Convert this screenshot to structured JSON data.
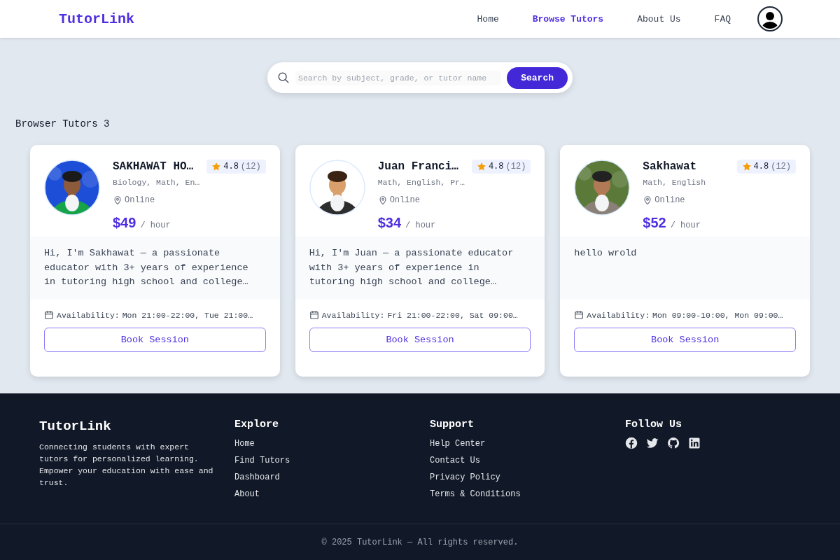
{
  "header": {
    "logo": "TutorLink",
    "nav": [
      {
        "label": "Home",
        "selected": false
      },
      {
        "label": "Browse Tutors",
        "selected": true
      },
      {
        "label": "About Us",
        "selected": false
      },
      {
        "label": "FAQ",
        "selected": false
      }
    ]
  },
  "search": {
    "placeholder": "Search by subject, grade, or tutor name",
    "button": "Search"
  },
  "heading": "Browser Tutors 3",
  "tutors": [
    {
      "name": "SAKHAWAT HO…",
      "rating": "4.8",
      "reviews": "(12)",
      "subjects": "Biology, Math, En…",
      "location": "Online",
      "price": "$49",
      "unit": "/ hour",
      "bio": "Hi, I'm Sakhawat — a passionate educator with 3+ years of experience in tutoring high school and college…",
      "availability_label": "Availability:",
      "availability": "Mon 21:00-22:00, Tue 21:00…",
      "button": "Book Session"
    },
    {
      "name": "Juan Franci…",
      "rating": "4.8",
      "reviews": "(12)",
      "subjects": "Math, English, Pr…",
      "location": "Online",
      "price": "$34",
      "unit": "/ hour",
      "bio": "Hi, I'm Juan — a passionate educator with 3+ years of experience in tutoring high school and college…",
      "availability_label": "Availability:",
      "availability": "Fri 21:00-22:00, Sat 09:00…",
      "button": "Book Session"
    },
    {
      "name": "Sakhawat",
      "rating": "4.8",
      "reviews": "(12)",
      "subjects": "Math, English",
      "location": "Online",
      "price": "$52",
      "unit": "/ hour",
      "bio": "hello wrold",
      "availability_label": "Availability:",
      "availability": "Mon 09:00-10:00, Mon 09:00…",
      "button": "Book Session"
    }
  ],
  "footer": {
    "brand": "TutorLink",
    "tagline": "Connecting students with expert tutors for personalized learning. Empower your education with ease and trust.",
    "columns": [
      {
        "title": "Explore",
        "links": [
          "Home",
          "Find Tutors",
          "Dashboard",
          "About"
        ]
      },
      {
        "title": "Support",
        "links": [
          "Help Center",
          "Contact Us",
          "Privacy Policy",
          "Terms & Conditions"
        ]
      }
    ],
    "follow_title": "Follow Us",
    "copyright": "© 2025 TutorLink — All rights reserved."
  }
}
